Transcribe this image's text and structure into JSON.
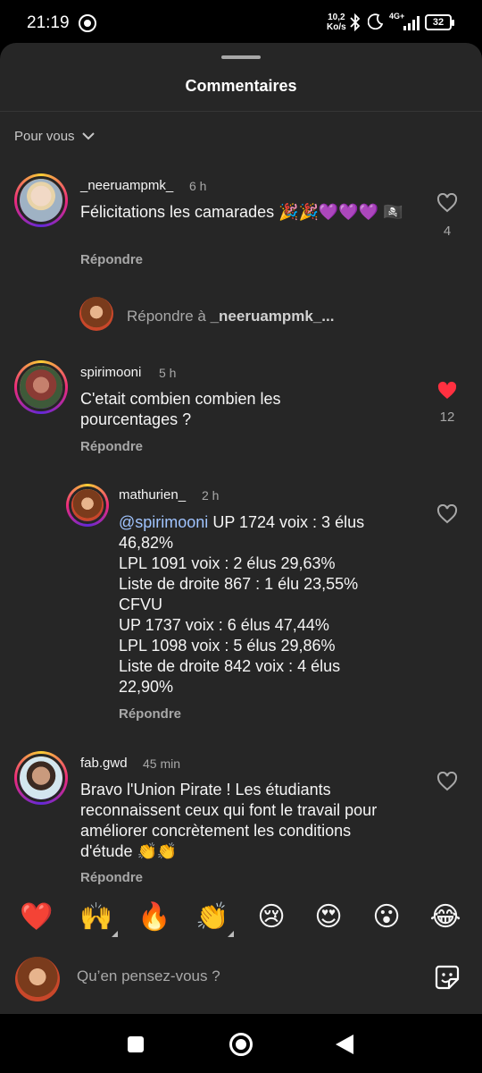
{
  "status_bar": {
    "time": "21:19",
    "speed_value": "10,2",
    "speed_unit": "Ko/s",
    "network": "4G+",
    "battery": "32",
    "icons": [
      "signal-app-icon",
      "bluetooth-icon",
      "moon-icon",
      "cell-signal-icon",
      "battery-icon"
    ]
  },
  "sheet": {
    "title": "Commentaires",
    "sort_label": "Pour vous"
  },
  "comments": [
    {
      "username": "_neeruampmk_",
      "time": "6 h",
      "text": "Félicitations les camarades 🎉🎉💜💜💜 🏴‍☠️",
      "reply_label": "Répondre",
      "likes": "4",
      "liked": false
    },
    {
      "reply_prompt_prefix": "Répondre à ",
      "reply_prompt_user": "_neeruampmk_...",
      "username": "spirimooni",
      "time": "5 h",
      "text": "C'etait combien combien les pourcentages ?",
      "reply_label": "Répondre",
      "likes": "12",
      "liked": true
    }
  ],
  "nested_reply": {
    "username": "mathurien_",
    "time": "2 h",
    "mention": "@spirimooni",
    "lines": [
      " UP 1724 voix : 3 élus",
      "46,82%",
      "LPL 1091 voix : 2 élus 29,63%",
      "Liste de droite 867 : 1 élu 23,55%",
      "CFVU",
      "UP 1737 voix : 6 élus 47,44%",
      "LPL 1098 voix : 5 élus 29,86%",
      "Liste de droite 842 voix : 4 élus",
      "22,90%"
    ],
    "reply_label": "Répondre"
  },
  "last_comment": {
    "username": "fab.gwd",
    "time": "45 min",
    "lines": [
      "Bravo l'Union Pirate ! Les étudiants",
      "reconnaissent ceux qui font le travail pour",
      "améliorer concrètement les conditions",
      "d'étude 👏👏"
    ],
    "reply_label": "Répondre"
  },
  "emoji_bar": [
    "❤️",
    "🙌",
    "🔥",
    "👏",
    "😢",
    "😍",
    "😮",
    "😂"
  ],
  "composer": {
    "placeholder": "Qu’en pensez-vous ?"
  },
  "colors": {
    "sheet_bg": "#262626",
    "liked_heart": "#ff3040",
    "mention": "#a0c4ff",
    "secondary_text": "#a8a8a8"
  }
}
